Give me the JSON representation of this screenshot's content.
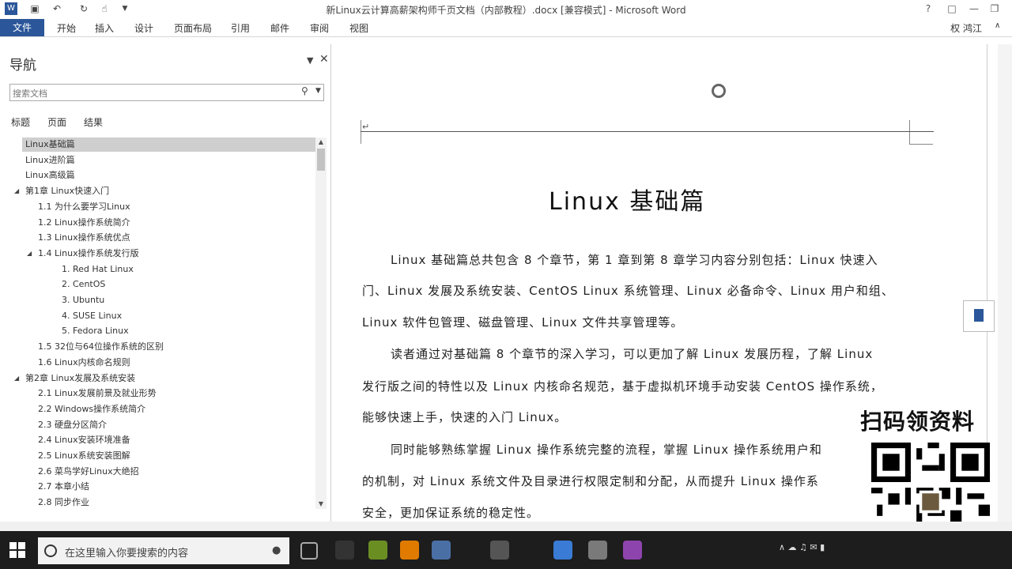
{
  "window": {
    "title": "新Linux云计算高薪架构师千页文档（内部教程）.docx [兼容模式] - Microsoft Word",
    "user": "权 鸿江"
  },
  "ribbon": {
    "file": "文件",
    "tabs": [
      "开始",
      "插入",
      "设计",
      "页面布局",
      "引用",
      "邮件",
      "审阅",
      "视图"
    ]
  },
  "nav": {
    "title": "导航",
    "search_placeholder": "搜索文档",
    "tabs": [
      "标题",
      "页面",
      "结果"
    ],
    "items": [
      {
        "label": "Linux基础篇",
        "level": 0,
        "selected": true
      },
      {
        "label": "Linux进阶篇",
        "level": 0
      },
      {
        "label": "Linux高级篇",
        "level": 0
      },
      {
        "label": "第1章  Linux快速入门",
        "level": 0,
        "expanded": true
      },
      {
        "label": "1.1   为什么要学习Linux",
        "level": 1
      },
      {
        "label": "1.2   Linux操作系统简介",
        "level": 1
      },
      {
        "label": "1.3   Linux操作系统优点",
        "level": 1
      },
      {
        "label": "1.4   Linux操作系统发行版",
        "level": 1,
        "expanded": true
      },
      {
        "label": "1. Red Hat Linux",
        "level": 2
      },
      {
        "label": "2. CentOS",
        "level": 2
      },
      {
        "label": "3. Ubuntu",
        "level": 2
      },
      {
        "label": "4. SUSE Linux",
        "level": 2
      },
      {
        "label": "5. Fedora Linux",
        "level": 2
      },
      {
        "label": "1.5   32位与64位操作系统的区别",
        "level": 1
      },
      {
        "label": "1.6   Linux内核命名规则",
        "level": 1
      },
      {
        "label": "第2章  Linux发展及系统安装",
        "level": 0,
        "expanded": true
      },
      {
        "label": "2.1   Linux发展前景及就业形势",
        "level": 1
      },
      {
        "label": "2.2   Windows操作系统简介",
        "level": 1
      },
      {
        "label": "2.3   硬盘分区简介",
        "level": 1
      },
      {
        "label": "2.4   Linux安装环境准备",
        "level": 1
      },
      {
        "label": "2.5   Linux系统安装图解",
        "level": 1
      },
      {
        "label": "2.6   菜鸟学好Linux大绝招",
        "level": 1
      },
      {
        "label": "2.7   本章小结",
        "level": 1
      },
      {
        "label": "2.8   同步作业",
        "level": 1
      }
    ]
  },
  "document": {
    "heading": "Linux 基础篇",
    "lines": [
      "Linux 基础篇总共包含 8 个章节，第 1 章到第 8 章学习内容分别包括：Linux 快速入",
      "门、Linux 发展及系统安装、CentOS Linux 系统管理、Linux 必备命令、Linux 用户和组、",
      "Linux 软件包管理、磁盘管理、Linux 文件共享管理等。",
      "读者通过对基础篇 8 个章节的深入学习，可以更加了解 Linux 发展历程，了解 Linux",
      "发行版之间的特性以及 Linux 内核命名规范，基于虚拟机环境手动安装 CentOS 操作系统，",
      "能够快速上手，快速的入门 Linux。",
      "同时能够熟练掌握 Linux 操作系统完整的流程，掌握 Linux 操作系统用户和",
      "的机制，对 Linux 系统文件及目录进行权限定制和分配，从而提升 Linux 操作系",
      "安全，更加保证系统的稳定性。"
    ]
  },
  "overlay": {
    "qr_caption": "扫码领资料"
  },
  "taskbar": {
    "search_placeholder": "在这里输入你要搜索的内容",
    "app_colors": [
      "#333333",
      "#6b8e23",
      "#e07b00",
      "#4a6fa5",
      "#555555",
      "#3a7bd5",
      "#7a7a7a",
      "#8e44ad",
      "#2b579a"
    ]
  }
}
